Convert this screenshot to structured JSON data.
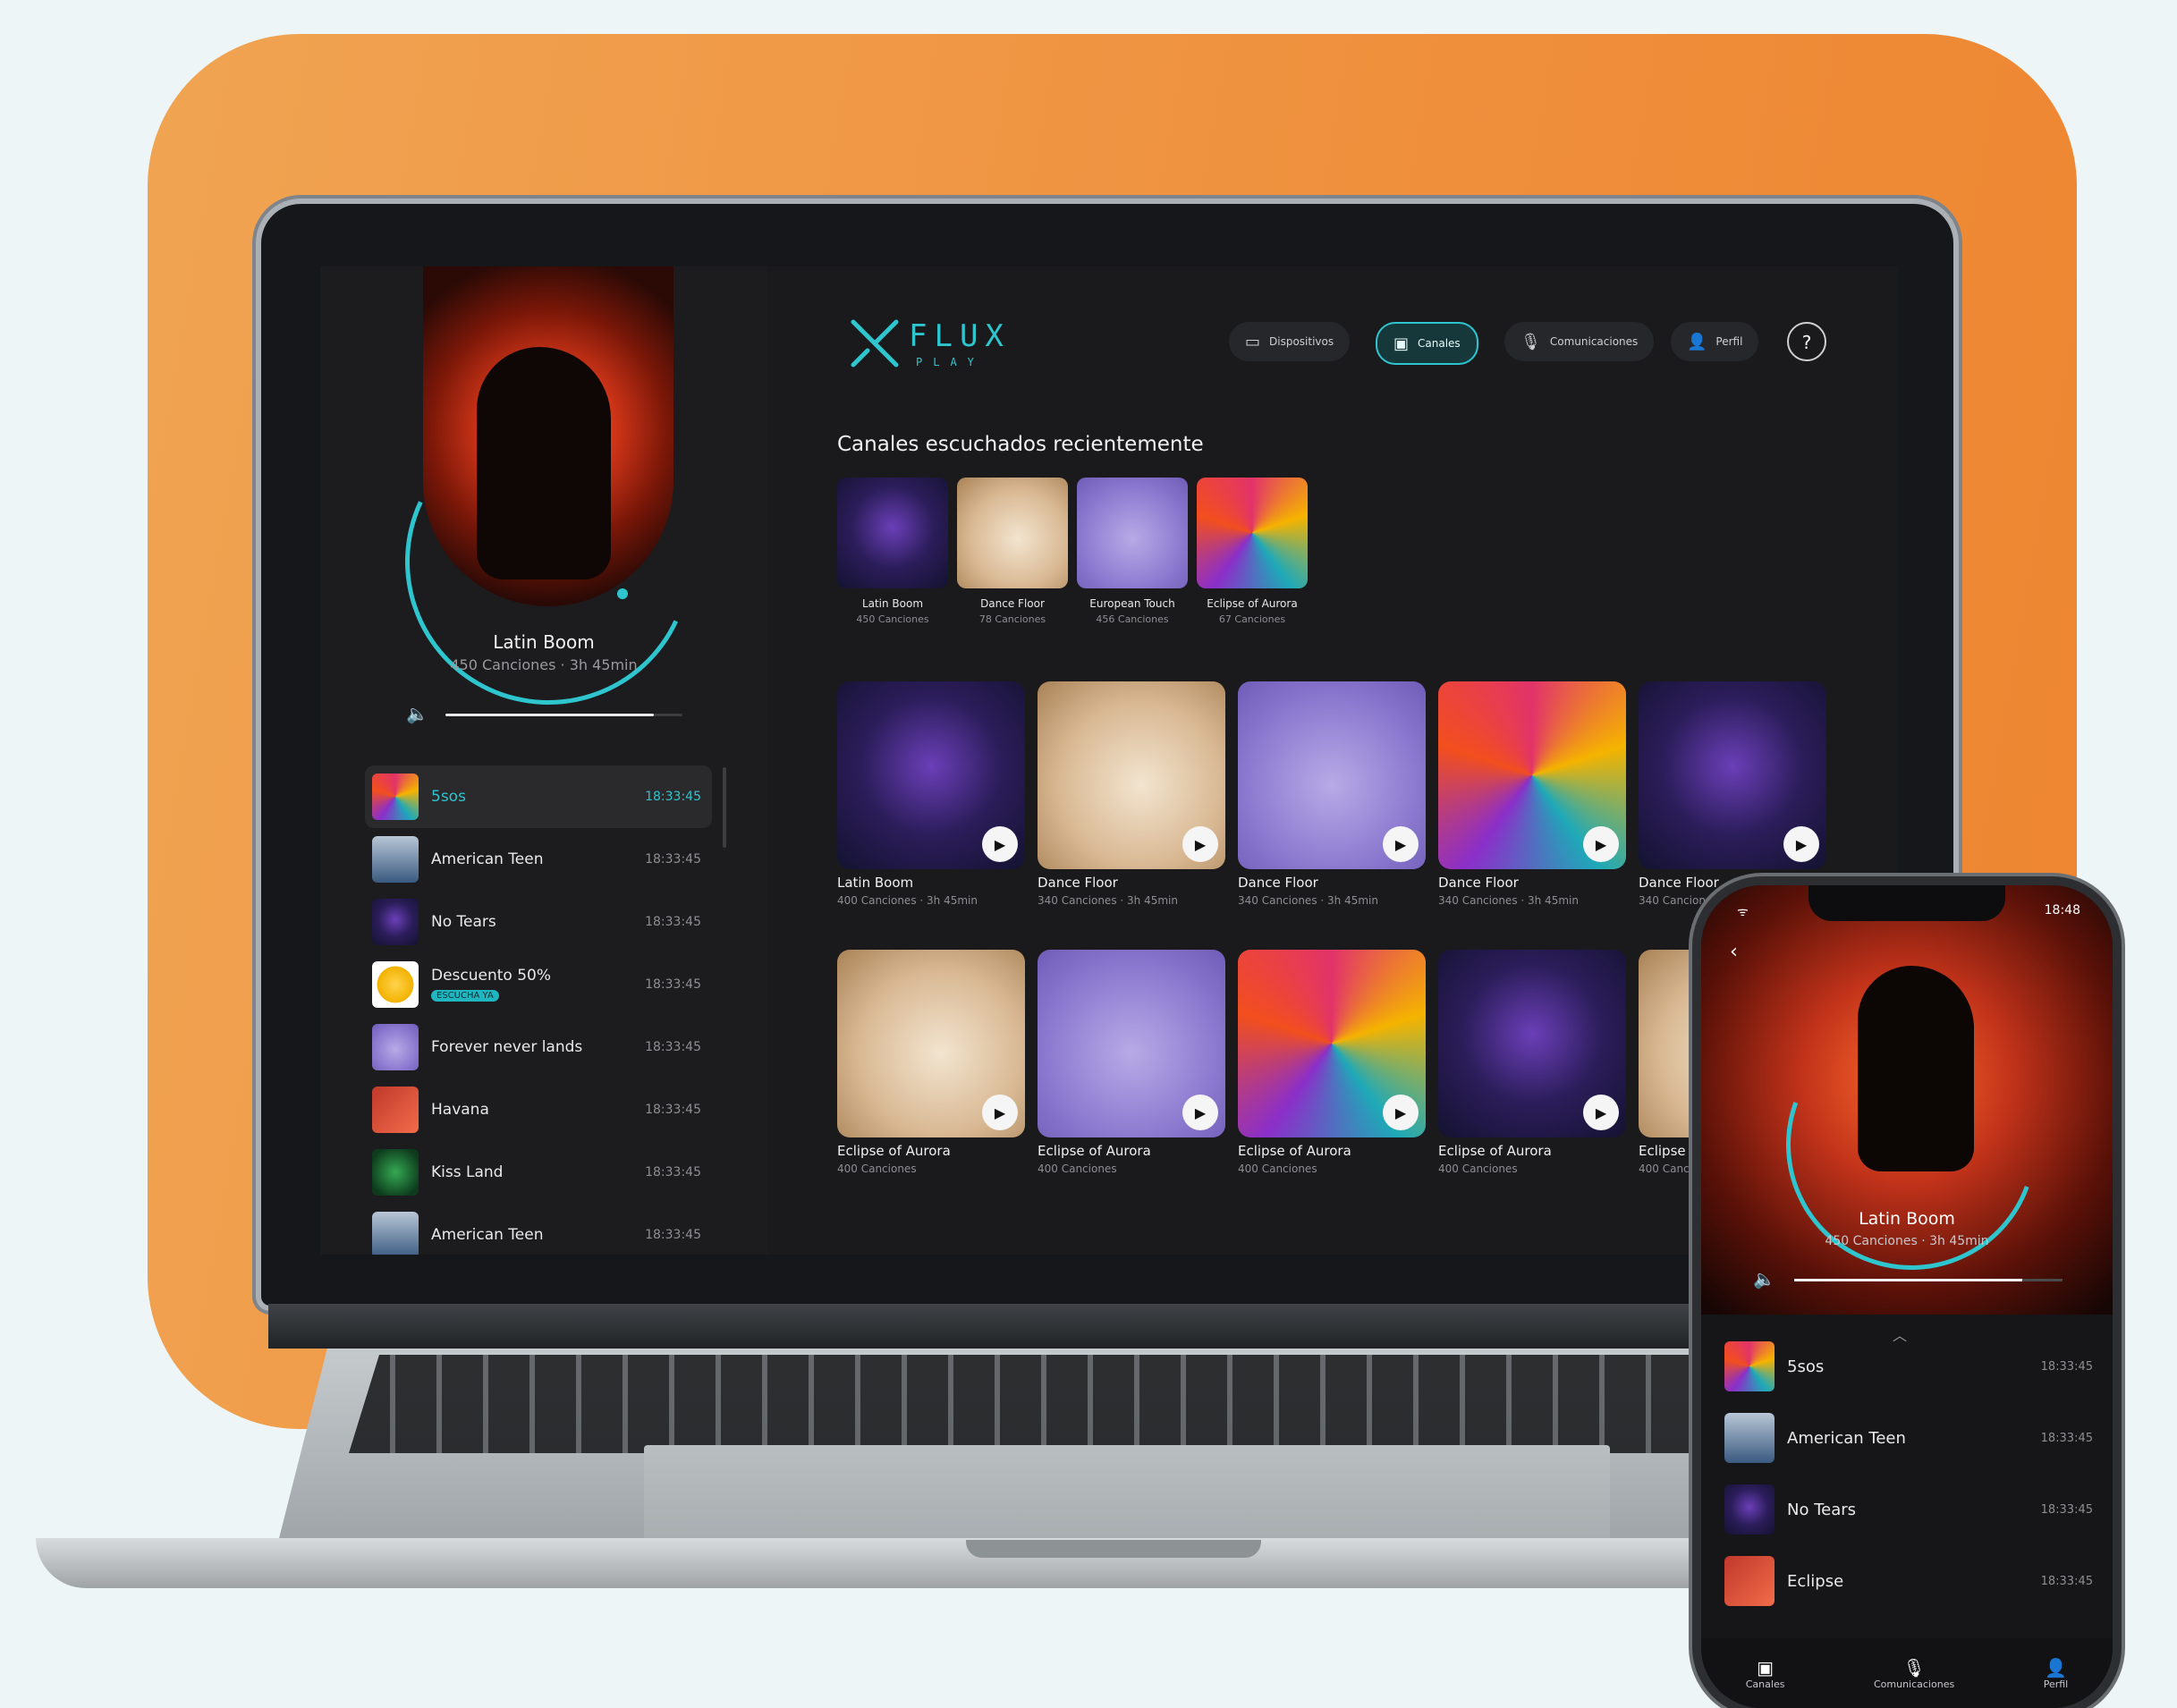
{
  "now_playing": {
    "title": "Latin Boom",
    "subtitle": "450 Canciones · 3h 45min",
    "volume_level": 0.88
  },
  "tracks": [
    {
      "name": "5sos",
      "time": "18:33:45",
      "active": true
    },
    {
      "name": "American Teen",
      "time": "18:33:45"
    },
    {
      "name": "No Tears",
      "time": "18:33:45"
    },
    {
      "name": "Descuento 50%",
      "time": "18:33:45",
      "badge": "ESCUCHA YA"
    },
    {
      "name": "Forever never lands",
      "time": "18:33:45"
    },
    {
      "name": "Havana",
      "time": "18:33:45"
    },
    {
      "name": "Kiss Land",
      "time": "18:33:45"
    },
    {
      "name": "American Teen",
      "time": "18:33:45"
    }
  ],
  "logo": {
    "word": "FLUX",
    "sub": "PLAY"
  },
  "nav": {
    "dispositivos": "Dispositivos",
    "canales": "Canales",
    "comunicaciones": "Comunicaciones",
    "perfil": "Perfil",
    "help": "?"
  },
  "recent": {
    "title": "Canales escuchados recientemente",
    "items": [
      {
        "title": "Latin Boom",
        "sub": "450 Canciones"
      },
      {
        "title": "Dance Floor",
        "sub": "78 Canciones"
      },
      {
        "title": "European Touch",
        "sub": "456 Canciones"
      },
      {
        "title": "Eclipse of Aurora",
        "sub": "67 Canciones"
      }
    ]
  },
  "grid_row1": [
    {
      "title": "Latin Boom",
      "sub": "400 Canciones · 3h 45min"
    },
    {
      "title": "Dance Floor",
      "sub": "340 Canciones · 3h 45min"
    },
    {
      "title": "Dance Floor",
      "sub": "340 Canciones · 3h 45min"
    },
    {
      "title": "Dance Floor",
      "sub": "340 Canciones · 3h 45min"
    },
    {
      "title": "Dance Floor",
      "sub": "340 Canciones · 3h 45min"
    }
  ],
  "grid_row2": [
    {
      "title": "Eclipse of Aurora",
      "sub": "400 Canciones"
    },
    {
      "title": "Eclipse of Aurora",
      "sub": "400 Canciones"
    },
    {
      "title": "Eclipse of Aurora",
      "sub": "400 Canciones"
    },
    {
      "title": "Eclipse of Aurora",
      "sub": "400 Canciones"
    },
    {
      "title": "Eclipse of Aurora",
      "sub": "400 Canciones"
    }
  ],
  "phone": {
    "status_time": "18:48",
    "title": "Latin Boom",
    "subtitle": "450 Canciones · 3h 45min",
    "volume_level": 0.85,
    "tracks": [
      {
        "name": "5sos",
        "time": "18:33:45"
      },
      {
        "name": "American Teen",
        "time": "18:33:45"
      },
      {
        "name": "No Tears",
        "time": "18:33:45"
      },
      {
        "name": "Eclipse",
        "time": "18:33:45"
      }
    ],
    "tabs": {
      "canales": "Canales",
      "comunicaciones": "Comunicaciones",
      "perfil": "Perfil"
    }
  },
  "colors": {
    "accent": "#2ec5cf",
    "background_orange": "#ef8f3c"
  },
  "icons": [
    "volume-icon",
    "devices-icon",
    "channels-icon",
    "microphone-icon",
    "user-icon",
    "play-icon",
    "back-chevron-icon",
    "wifi-icon"
  ]
}
